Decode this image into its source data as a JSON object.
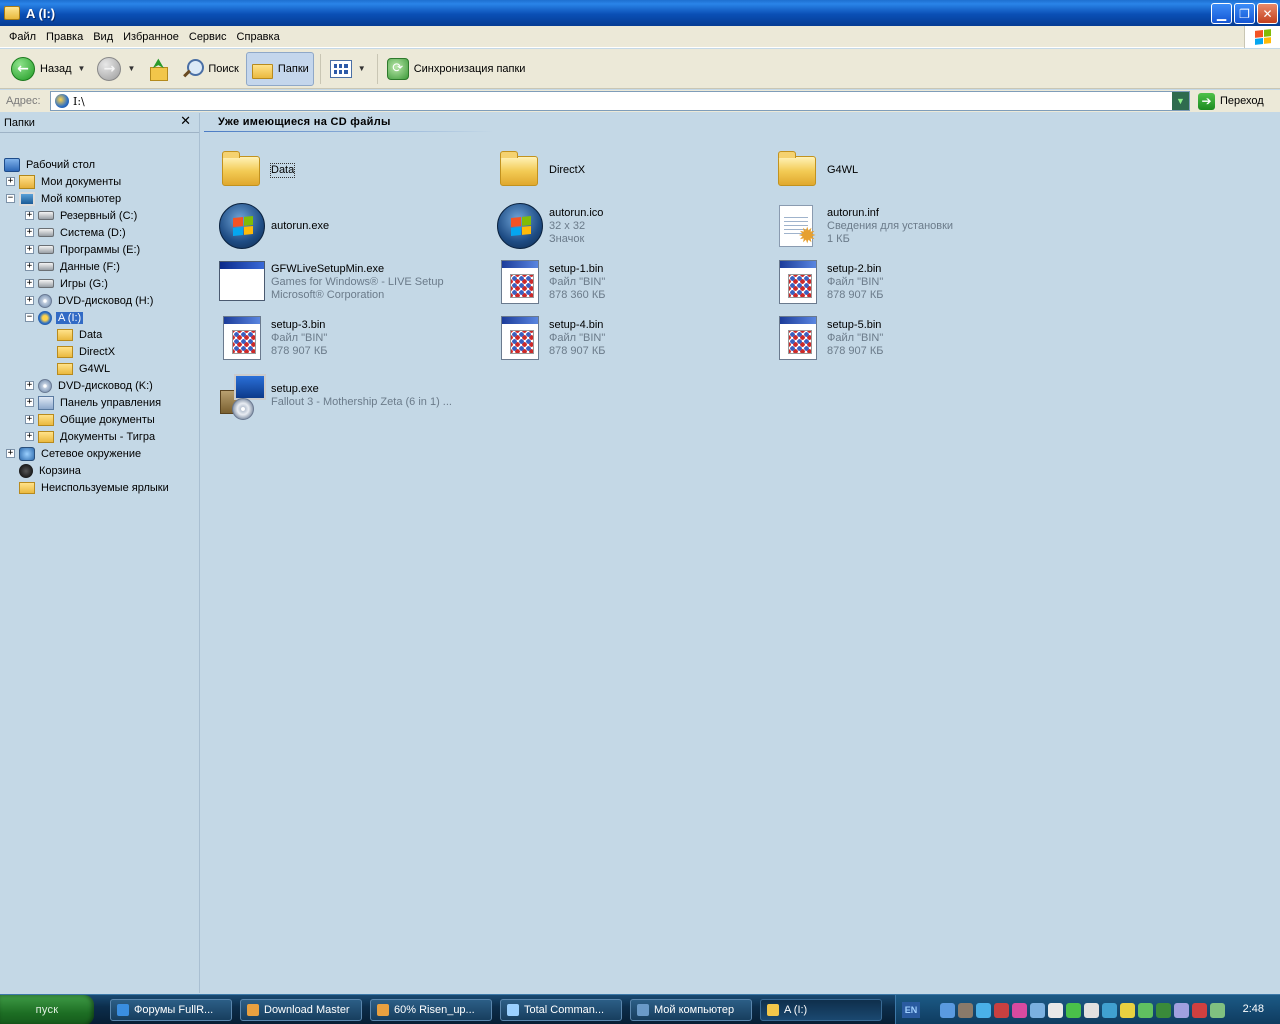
{
  "window": {
    "title": "A (I:)",
    "buttons": {
      "minimize": "▁",
      "maximize": "❐",
      "close": "✕"
    }
  },
  "menu": [
    "Файл",
    "Правка",
    "Вид",
    "Избранное",
    "Сервис",
    "Справка"
  ],
  "toolbar": {
    "back_label": "Назад",
    "search_label": "Поиск",
    "folders_label": "Папки",
    "sync_label": "Синхронизация папки"
  },
  "address": {
    "label": "Адрес:",
    "value": "I:\\",
    "go_label": "Переход"
  },
  "folders_pane": {
    "title": "Папки",
    "close": "✕",
    "items": [
      {
        "label": "Рабочий стол",
        "icon": "desktop-icon",
        "indent": 0,
        "expander": ""
      },
      {
        "label": "Мои документы",
        "icon": "documents-icon",
        "indent": 1,
        "expander": "+"
      },
      {
        "label": "Мой компьютер",
        "icon": "computer-icon",
        "indent": 1,
        "expander": "−"
      },
      {
        "label": "Резервный (C:)",
        "icon": "drive-icon",
        "indent": 2,
        "expander": "+"
      },
      {
        "label": "Система (D:)",
        "icon": "drive-icon",
        "indent": 2,
        "expander": "+"
      },
      {
        "label": "Программы (E:)",
        "icon": "drive-icon",
        "indent": 2,
        "expander": "+"
      },
      {
        "label": "Данные (F:)",
        "icon": "drive-icon",
        "indent": 2,
        "expander": "+"
      },
      {
        "label": "Игры (G:)",
        "icon": "drive-icon",
        "indent": 2,
        "expander": "+"
      },
      {
        "label": "DVD-дисковод (H:)",
        "icon": "dvd-icon",
        "indent": 2,
        "expander": "+"
      },
      {
        "label": "A (I:)",
        "icon": "cd-icon",
        "indent": 2,
        "expander": "−",
        "selected": true
      },
      {
        "label": "Data",
        "icon": "folder-icon",
        "indent": 3,
        "expander": ""
      },
      {
        "label": "DirectX",
        "icon": "folder-icon",
        "indent": 3,
        "expander": ""
      },
      {
        "label": "G4WL",
        "icon": "folder-icon",
        "indent": 3,
        "expander": ""
      },
      {
        "label": "DVD-дисковод (K:)",
        "icon": "dvd-icon",
        "indent": 2,
        "expander": "+"
      },
      {
        "label": "Панель управления",
        "icon": "control-panel-icon",
        "indent": 2,
        "expander": "+"
      },
      {
        "label": "Общие документы",
        "icon": "folder-icon",
        "indent": 2,
        "expander": "+"
      },
      {
        "label": "Документы - Тигра",
        "icon": "folder-icon",
        "indent": 2,
        "expander": "+"
      },
      {
        "label": "Сетевое окружение",
        "icon": "network-icon",
        "indent": 1,
        "expander": "+"
      },
      {
        "label": "Корзина",
        "icon": "recycle-bin-icon",
        "indent": 1,
        "expander": ""
      },
      {
        "label": "Неиспользуемые ярлыки",
        "icon": "folder-icon",
        "indent": 1,
        "expander": ""
      }
    ]
  },
  "content": {
    "group_title": "Уже имеющиеся на CD файлы",
    "files": [
      {
        "name": "Data",
        "lines": [],
        "icon": "folder-icon",
        "focused": true
      },
      {
        "name": "DirectX",
        "lines": [],
        "icon": "folder-icon"
      },
      {
        "name": "G4WL",
        "lines": [],
        "icon": "folder-icon"
      },
      {
        "name": "autorun.exe",
        "lines": [],
        "icon": "windows-orb-icon"
      },
      {
        "name": "autorun.ico",
        "lines": [
          "32 x 32",
          "Значок"
        ],
        "icon": "windows-orb-icon"
      },
      {
        "name": "autorun.inf",
        "lines": [
          "Сведения для установки",
          "1 КБ"
        ],
        "icon": "setup-info-icon"
      },
      {
        "name": "GFWLiveSetupMin.exe",
        "lines": [
          "Games for Windows® - LIVE Setup",
          "Microsoft® Corporation"
        ],
        "icon": "application-window-icon"
      },
      {
        "name": "setup-1.bin",
        "lines": [
          "Файл \"BIN\"",
          "878 360 КБ"
        ],
        "icon": "bin-file-icon"
      },
      {
        "name": "setup-2.bin",
        "lines": [
          "Файл \"BIN\"",
          "878 907 КБ"
        ],
        "icon": "bin-file-icon"
      },
      {
        "name": "setup-3.bin",
        "lines": [
          "Файл \"BIN\"",
          "878 907 КБ"
        ],
        "icon": "bin-file-icon"
      },
      {
        "name": "setup-4.bin",
        "lines": [
          "Файл \"BIN\"",
          "878 907 КБ"
        ],
        "icon": "bin-file-icon"
      },
      {
        "name": "setup-5.bin",
        "lines": [
          "Файл \"BIN\"",
          "878 907 КБ"
        ],
        "icon": "bin-file-icon"
      },
      {
        "name": "setup.exe",
        "lines": [
          "Fallout 3 - Mothership Zeta (6 in 1) ..."
        ],
        "icon": "setup-installer-icon"
      }
    ]
  },
  "taskbar": {
    "start_label": "пуск",
    "tasks": [
      {
        "label": "Форумы FullR...",
        "icon": "ie-icon",
        "color": "#3a8ee0"
      },
      {
        "label": "Download Master",
        "icon": "download-master-icon",
        "color": "#e8a040"
      },
      {
        "label": "60% Risen_up...",
        "icon": "download-icon",
        "color": "#e8a040"
      },
      {
        "label": "Total Comman...",
        "icon": "total-commander-icon",
        "color": "#9ad0ff"
      },
      {
        "label": "Мой компьютер",
        "icon": "computer-icon",
        "color": "#6a9ac8"
      },
      {
        "label": "A (I:)",
        "icon": "folder-icon",
        "color": "#f2c64a",
        "active": true
      }
    ],
    "tray": {
      "lang": "EN",
      "clock": "2:48",
      "icon_colors": [
        "#5a9ae0",
        "#8a7a6a",
        "#4ab0e8",
        "#c84040",
        "#d84aa0",
        "#7ab0e0",
        "#e8e8e8",
        "#4ac04a",
        "#e0e0e0",
        "#40a0d0",
        "#e8d040",
        "#60c060",
        "#3a8a3a",
        "#a0a0e0",
        "#d04040",
        "#80c080"
      ]
    }
  }
}
